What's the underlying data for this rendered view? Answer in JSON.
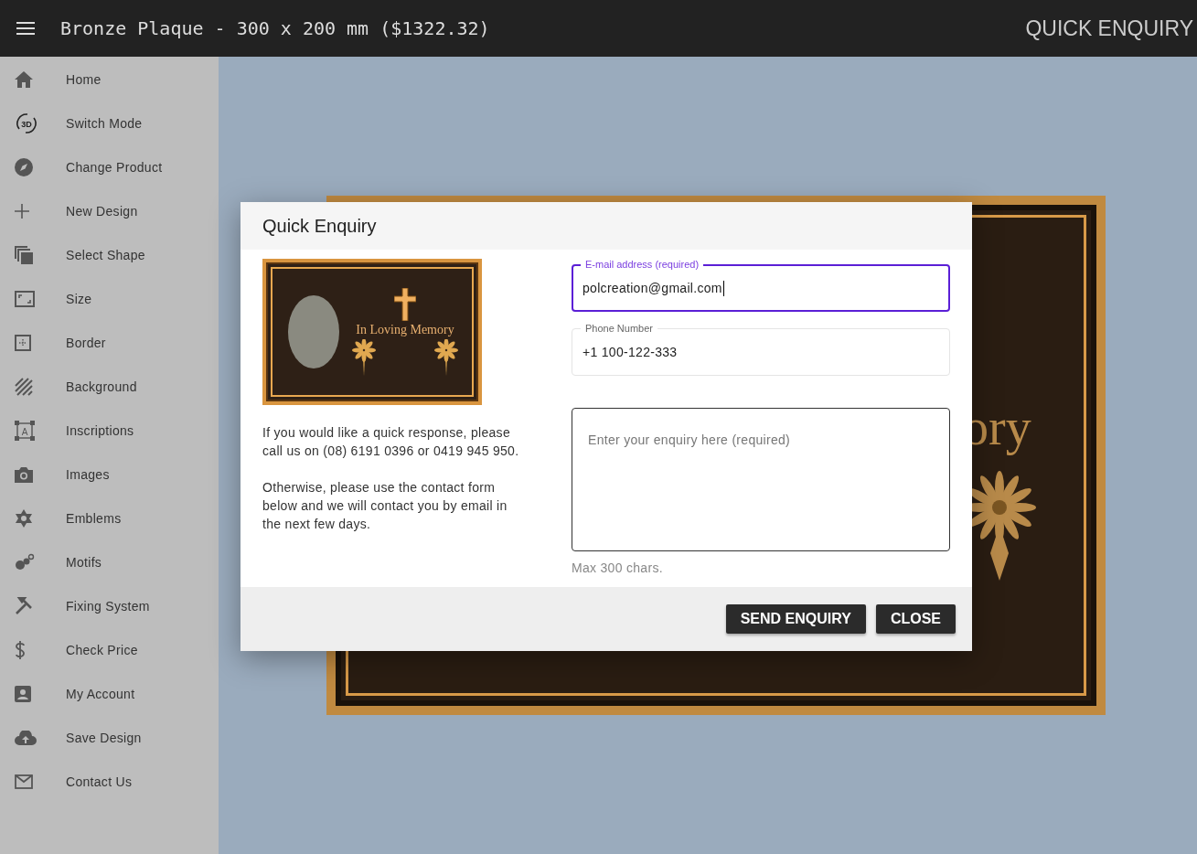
{
  "top_bar": {
    "title": "Bronze Plaque - 300 x 200 mm ($1322.32)",
    "action": "QUICK ENQUIRY"
  },
  "sidebar": {
    "items": [
      {
        "label": "Home"
      },
      {
        "label": "Switch Mode",
        "badge": "3D"
      },
      {
        "label": "Change Product"
      },
      {
        "label": "New Design"
      },
      {
        "label": "Select Shape"
      },
      {
        "label": "Size"
      },
      {
        "label": "Border"
      },
      {
        "label": "Background"
      },
      {
        "label": "Inscriptions",
        "badge": "A"
      },
      {
        "label": "Images"
      },
      {
        "label": "Emblems"
      },
      {
        "label": "Motifs"
      },
      {
        "label": "Fixing System"
      },
      {
        "label": "Check Price"
      },
      {
        "label": "My Account"
      },
      {
        "label": "Save Design"
      },
      {
        "label": "Contact Us"
      }
    ]
  },
  "canvas": {
    "plaque_text": "ory"
  },
  "dialog": {
    "title": "Quick Enquiry",
    "preview": {
      "inscription": "In Loving Memory"
    },
    "paragraphs": [
      "If you would like a quick response, please call us on (08) 6191 0396 or 0419 945 950.",
      "Otherwise, please use the contact form below and we will contact you by email in the next few days."
    ],
    "fields": [
      {
        "label": "E-mail address (required)",
        "value": "polcreation@gmail.com",
        "focused": true
      },
      {
        "label": "Phone Number",
        "value": "+1 100-122-333",
        "focused": false
      }
    ],
    "enquiry": {
      "placeholder": "Enter your enquiry here (required)",
      "hint": "Max 300 chars."
    },
    "buttons": [
      "SEND ENQUIRY",
      "CLOSE"
    ]
  }
}
